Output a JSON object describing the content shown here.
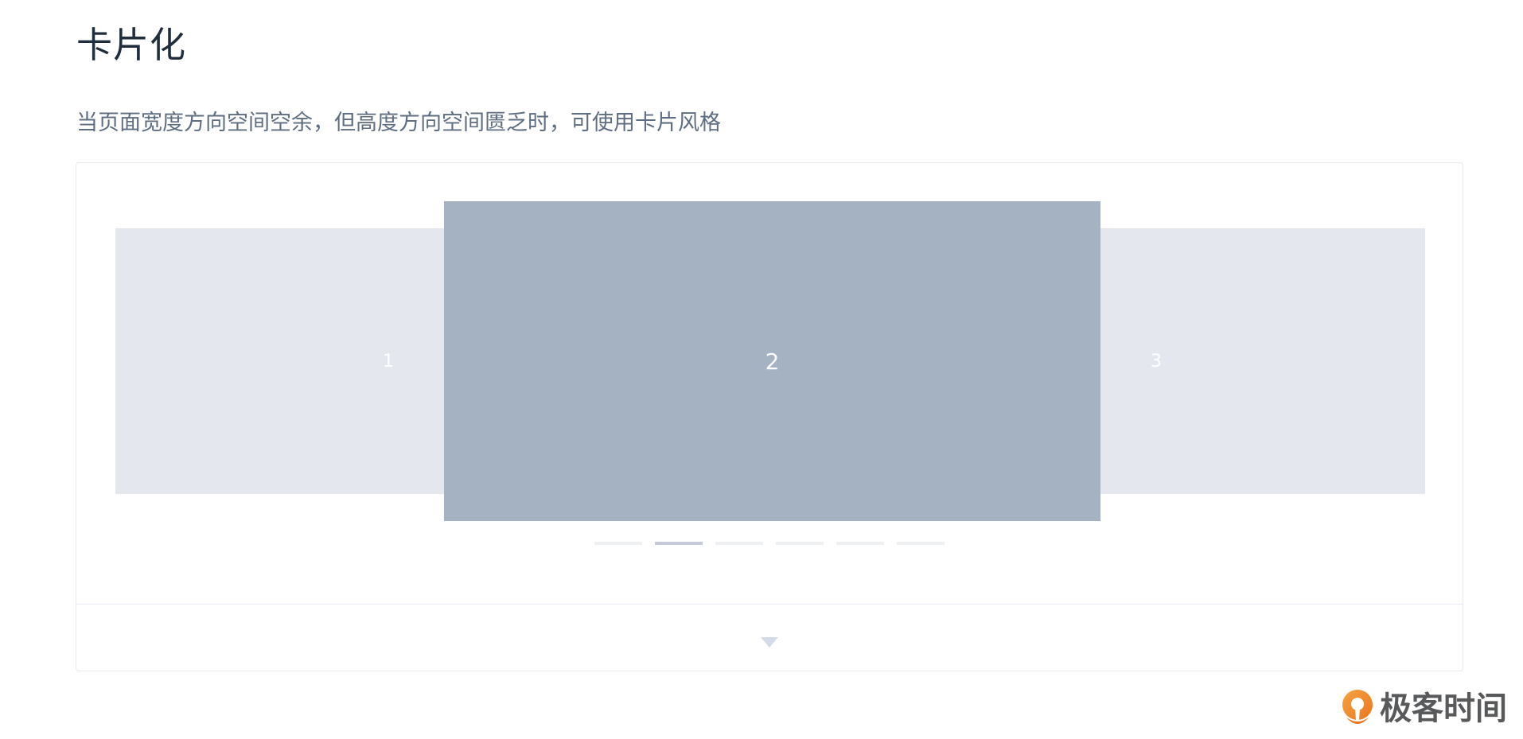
{
  "section": {
    "title": "卡片化",
    "description": "当页面宽度方向空间空余，但高度方向空间匮乏时，可使用卡片风格"
  },
  "carousel": {
    "items": [
      {
        "label": "1",
        "state": "inactive"
      },
      {
        "label": "2",
        "state": "active"
      },
      {
        "label": "3",
        "state": "inactive"
      }
    ],
    "indicator_count": 6,
    "active_index": 1,
    "colors": {
      "active_card": "#a5b2c2",
      "side_card": "#e4e8ee",
      "indicator": "#eef0f3",
      "indicator_active": "#c4cad6"
    }
  },
  "footer": {
    "toggle_icon": "caret-down-icon"
  },
  "watermark": {
    "text": "极客时间",
    "logo_icon": "geektime-logo-icon",
    "logo_color": "#f08c2b"
  }
}
